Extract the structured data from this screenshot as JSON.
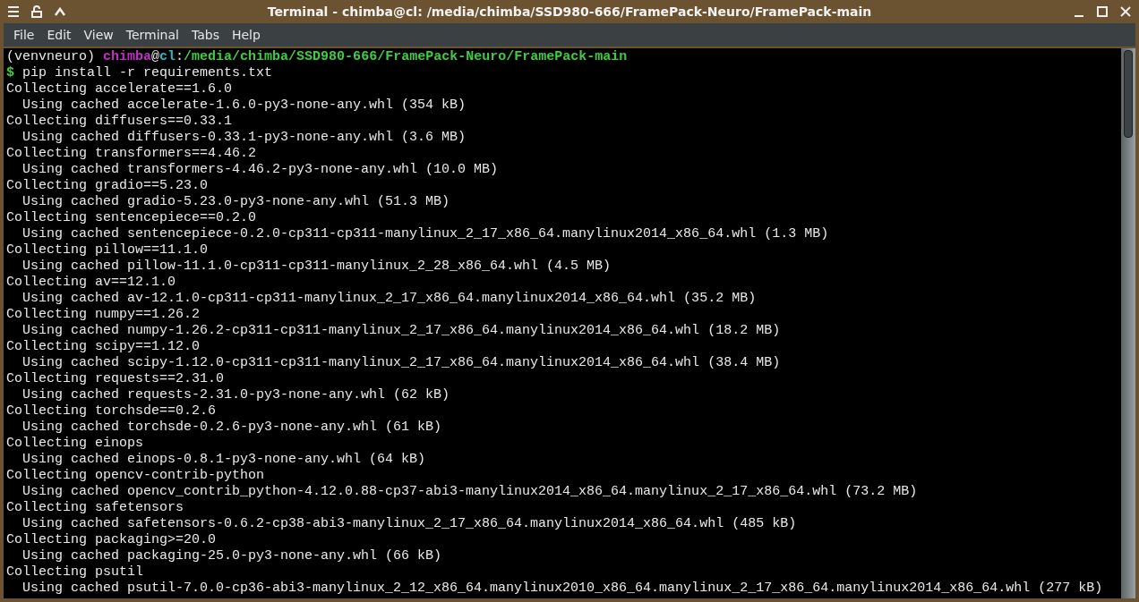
{
  "window": {
    "title": "Terminal - chimba@cl: /media/chimba/SSD980-666/FramePack-Neuro/FramePack-main"
  },
  "menu": [
    "File",
    "Edit",
    "View",
    "Terminal",
    "Tabs",
    "Help"
  ],
  "terminal": {
    "lines": [
      {
        "kind": "prompt",
        "segments": [
          {
            "kind": "env",
            "text": "(venvneuro) "
          },
          {
            "kind": "user",
            "text": "chimba"
          },
          {
            "kind": "plain",
            "text": "@"
          },
          {
            "kind": "host",
            "text": "cl"
          },
          {
            "kind": "plain",
            "text": ":"
          },
          {
            "kind": "path",
            "text": "/media/chimba/SSD980-666/FramePack-Neuro/FramePack-main"
          }
        ]
      },
      {
        "kind": "command",
        "segments": [
          {
            "kind": "dollar",
            "text": "$"
          },
          {
            "kind": "plain",
            "text": " pip install -r requirements.txt"
          }
        ]
      },
      {
        "kind": "output",
        "text": "Collecting accelerate==1.6.0"
      },
      {
        "kind": "output",
        "text": "  Using cached accelerate-1.6.0-py3-none-any.whl (354 kB)"
      },
      {
        "kind": "output",
        "text": "Collecting diffusers==0.33.1"
      },
      {
        "kind": "output",
        "text": "  Using cached diffusers-0.33.1-py3-none-any.whl (3.6 MB)"
      },
      {
        "kind": "output",
        "text": "Collecting transformers==4.46.2"
      },
      {
        "kind": "output",
        "text": "  Using cached transformers-4.46.2-py3-none-any.whl (10.0 MB)"
      },
      {
        "kind": "output",
        "text": "Collecting gradio==5.23.0"
      },
      {
        "kind": "output",
        "text": "  Using cached gradio-5.23.0-py3-none-any.whl (51.3 MB)"
      },
      {
        "kind": "output",
        "text": "Collecting sentencepiece==0.2.0"
      },
      {
        "kind": "output",
        "text": "  Using cached sentencepiece-0.2.0-cp311-cp311-manylinux_2_17_x86_64.manylinux2014_x86_64.whl (1.3 MB)"
      },
      {
        "kind": "output",
        "text": "Collecting pillow==11.1.0"
      },
      {
        "kind": "output",
        "text": "  Using cached pillow-11.1.0-cp311-cp311-manylinux_2_28_x86_64.whl (4.5 MB)"
      },
      {
        "kind": "output",
        "text": "Collecting av==12.1.0"
      },
      {
        "kind": "output",
        "text": "  Using cached av-12.1.0-cp311-cp311-manylinux_2_17_x86_64.manylinux2014_x86_64.whl (35.2 MB)"
      },
      {
        "kind": "output",
        "text": "Collecting numpy==1.26.2"
      },
      {
        "kind": "output",
        "text": "  Using cached numpy-1.26.2-cp311-cp311-manylinux_2_17_x86_64.manylinux2014_x86_64.whl (18.2 MB)"
      },
      {
        "kind": "output",
        "text": "Collecting scipy==1.12.0"
      },
      {
        "kind": "output",
        "text": "  Using cached scipy-1.12.0-cp311-cp311-manylinux_2_17_x86_64.manylinux2014_x86_64.whl (38.4 MB)"
      },
      {
        "kind": "output",
        "text": "Collecting requests==2.31.0"
      },
      {
        "kind": "output",
        "text": "  Using cached requests-2.31.0-py3-none-any.whl (62 kB)"
      },
      {
        "kind": "output",
        "text": "Collecting torchsde==0.2.6"
      },
      {
        "kind": "output",
        "text": "  Using cached torchsde-0.2.6-py3-none-any.whl (61 kB)"
      },
      {
        "kind": "output",
        "text": "Collecting einops"
      },
      {
        "kind": "output",
        "text": "  Using cached einops-0.8.1-py3-none-any.whl (64 kB)"
      },
      {
        "kind": "output",
        "text": "Collecting opencv-contrib-python"
      },
      {
        "kind": "output",
        "text": "  Using cached opencv_contrib_python-4.12.0.88-cp37-abi3-manylinux2014_x86_64.manylinux_2_17_x86_64.whl (73.2 MB)"
      },
      {
        "kind": "output",
        "text": "Collecting safetensors"
      },
      {
        "kind": "output",
        "text": "  Using cached safetensors-0.6.2-cp38-abi3-manylinux_2_17_x86_64.manylinux2014_x86_64.whl (485 kB)"
      },
      {
        "kind": "output",
        "text": "Collecting packaging>=20.0"
      },
      {
        "kind": "output",
        "text": "  Using cached packaging-25.0-py3-none-any.whl (66 kB)"
      },
      {
        "kind": "output",
        "text": "Collecting psutil"
      },
      {
        "kind": "output",
        "text": "  Using cached psutil-7.0.0-cp36-abi3-manylinux_2_12_x86_64.manylinux2010_x86_64.manylinux_2_17_x86_64.manylinux2014_x86_64.whl (277 kB)"
      }
    ]
  }
}
